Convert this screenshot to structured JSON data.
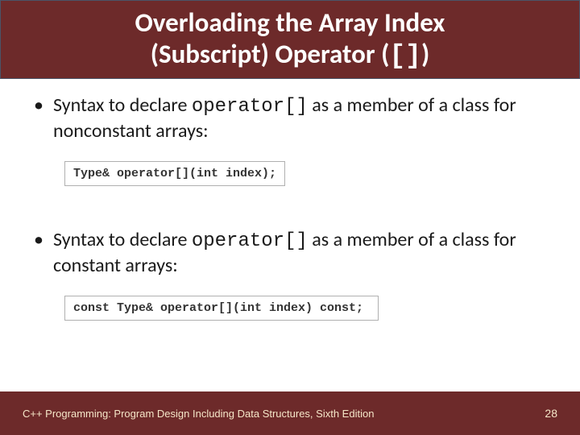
{
  "header": {
    "title_line1": "Overloading the Array Index",
    "title_line2_prefix": "(Subscript) Operator (",
    "title_line2_code": "[]",
    "title_line2_suffix": ")"
  },
  "bullets": {
    "b1_prefix": "Syntax to declare ",
    "b1_code": "operator[]",
    "b1_suffix": " as a member of a class for nonconstant arrays:",
    "b2_prefix": "Syntax to declare ",
    "b2_code": "operator[]",
    "b2_suffix": " as a member of a class for constant arrays:"
  },
  "code": {
    "box1": "Type& operator[](int index);",
    "box2": "const Type& operator[](int index) const;"
  },
  "footer": {
    "left": "C++ Programming: Program Design Including Data Structures, Sixth Edition",
    "page": "28"
  }
}
